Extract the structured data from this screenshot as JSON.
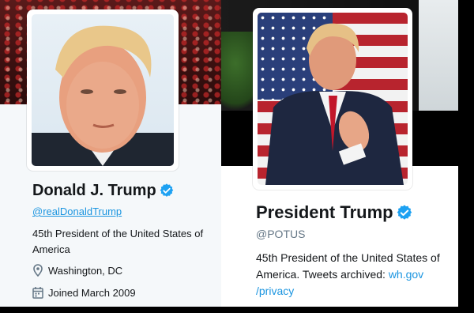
{
  "left_profile": {
    "name": "Donald J. Trump",
    "handle": "@realDonaldTrump",
    "bio": "45th President of the United States of America",
    "location": "Washington, DC",
    "joined": "Joined March 2009",
    "icons": [
      "verified-badge-icon",
      "location-pin-icon",
      "calendar-icon"
    ]
  },
  "right_profile": {
    "name": "President Trump",
    "handle": "@POTUS",
    "bio_text": "45th President of the United States of America. Tweets archived: ",
    "bio_link_1": "wh.gov",
    "bio_link_2": "/privacy",
    "icons": [
      "verified-badge-icon"
    ]
  },
  "colors": {
    "link": "#1b95e0",
    "verified": "#1da1f2",
    "text": "#14171a",
    "muted": "#657786"
  }
}
